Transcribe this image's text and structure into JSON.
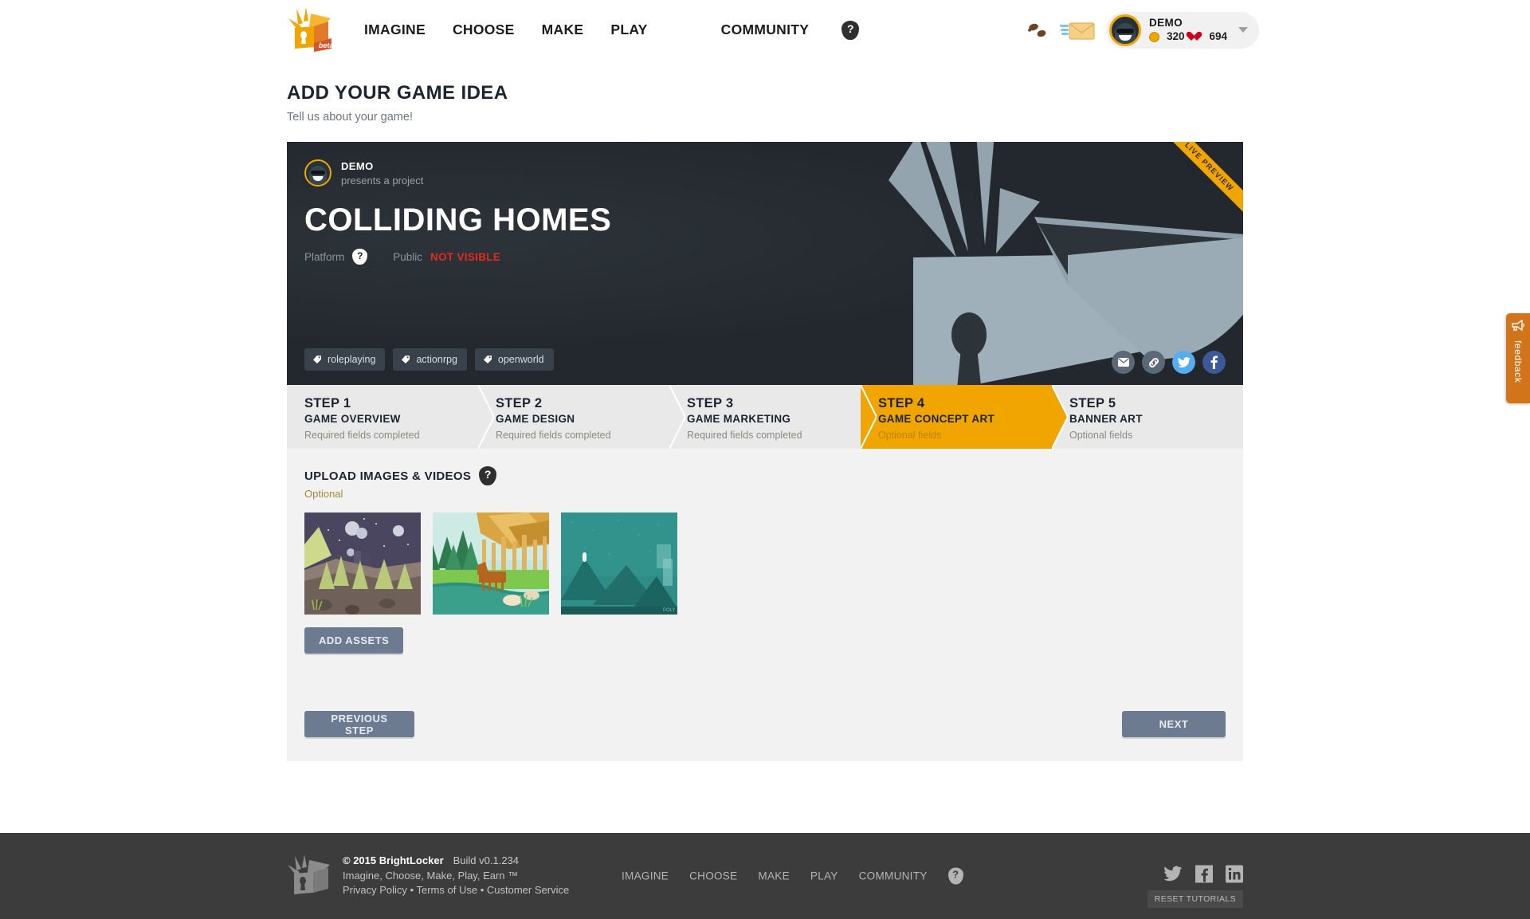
{
  "header": {
    "logo_alt": "brightlocker-logo",
    "beta_label": "beta",
    "nav": [
      {
        "label": "IMAGINE"
      },
      {
        "label": "CHOOSE"
      },
      {
        "label": "MAKE"
      },
      {
        "label": "PLAY"
      },
      {
        "label": "COMMUNITY"
      }
    ],
    "help_label": "?",
    "user": {
      "name": "DEMO",
      "coins": "320",
      "hearts": "694"
    }
  },
  "page": {
    "title": "ADD YOUR GAME IDEA",
    "subtitle": "Tell us about your game!"
  },
  "game_card": {
    "ribbon": "LIVE PREVIEW",
    "presenter_name": "DEMO",
    "presenter_sub": "presents a project",
    "game_title": "COLLIDING HOMES",
    "platform_label": "Platform",
    "platform_help": "?",
    "public_label": "Public",
    "visibility_status": "NOT VISIBLE",
    "visibility_color": "#e02b20",
    "tags": [
      "roleplaying",
      "actionrpg",
      "openworld"
    ],
    "socials": [
      "email-icon",
      "link-icon",
      "twitter-icon",
      "facebook-icon"
    ]
  },
  "steps": [
    {
      "num": "STEP 1",
      "name": "GAME OVERVIEW",
      "status": "Required fields completed",
      "active": false
    },
    {
      "num": "STEP 2",
      "name": "GAME DESIGN",
      "status": "Required fields completed",
      "active": false
    },
    {
      "num": "STEP 3",
      "name": "GAME MARKETING",
      "status": "Required fields completed",
      "active": false
    },
    {
      "num": "STEP 4",
      "name": "GAME CONCEPT ART",
      "status": "Optional fields",
      "active": true
    },
    {
      "num": "STEP 5",
      "name": "BANNER ART",
      "status": "Optional fields",
      "active": false
    }
  ],
  "upload_section": {
    "title": "UPLOAD IMAGES & VIDEOS",
    "help": "?",
    "optional_label": "Optional",
    "thumbnails": [
      {
        "name": "night-forest-lowpoly"
      },
      {
        "name": "deer-river-lowpoly"
      },
      {
        "name": "teal-mountains-lowpoly"
      }
    ],
    "add_assets_label": "ADD ASSETS"
  },
  "nav_buttons": {
    "previous_label": "PREVIOUS STEP",
    "next_label": "NEXT"
  },
  "feedback": {
    "label": "feedback",
    "accent": "#d2751a"
  },
  "footer": {
    "copyright": "© 2015 BrightLocker",
    "build": "Build v0.1.234",
    "tagline": "Imagine, Choose, Make, Play, Earn ™",
    "legal": [
      {
        "label": "Privacy Policy"
      },
      {
        "label": "Terms of Use"
      },
      {
        "label": "Customer Service"
      }
    ],
    "legal_sep": "•",
    "nav": [
      {
        "label": "IMAGINE"
      },
      {
        "label": "CHOOSE"
      },
      {
        "label": "MAKE"
      },
      {
        "label": "PLAY"
      },
      {
        "label": "COMMUNITY"
      }
    ],
    "help_label": "?",
    "socials": [
      "twitter-icon",
      "facebook-icon",
      "linkedin-icon"
    ],
    "reset_tutorials_label": "RESET TUTORIALS"
  },
  "theme": {
    "brand_orange": "#f0a500",
    "card_dark": "#23282e",
    "button_slate": "#6c7b8f",
    "footer_dark": "#3c3c3c"
  }
}
